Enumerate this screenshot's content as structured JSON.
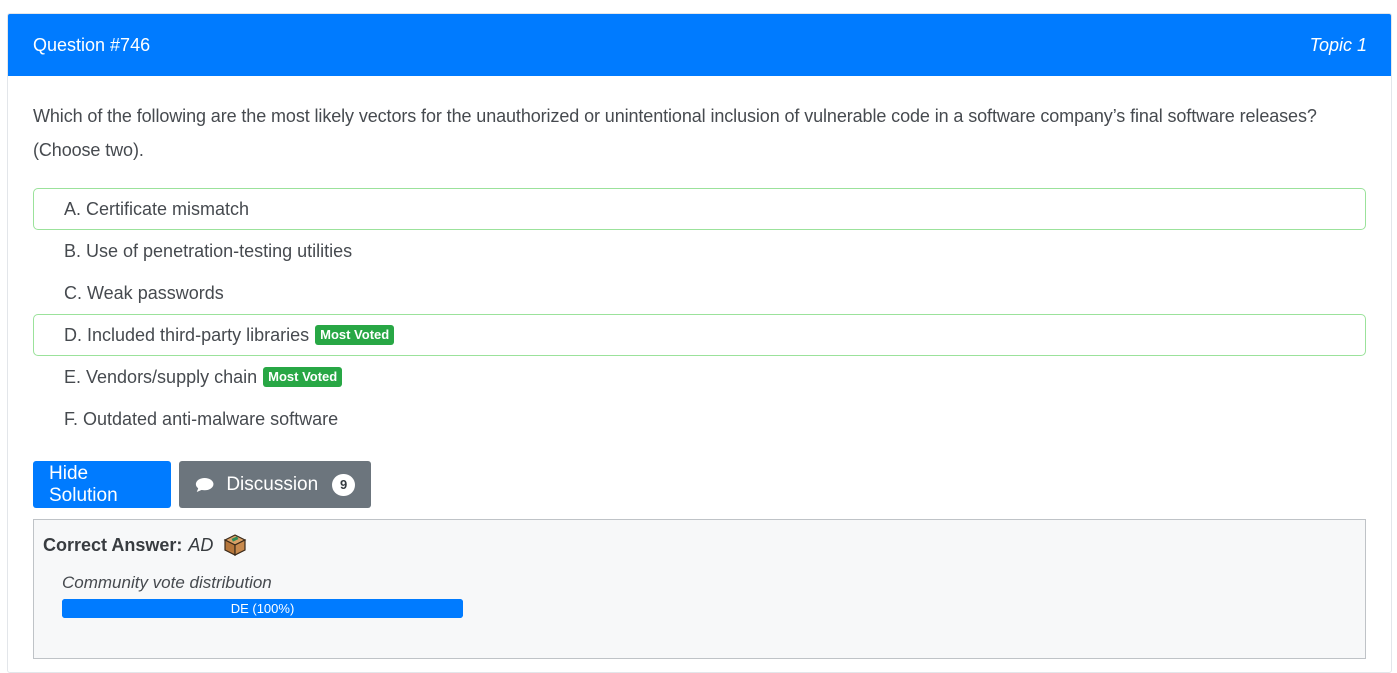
{
  "header": {
    "question": "Question #746",
    "topic": "Topic 1"
  },
  "question_text": "Which of the following are the most likely vectors for the unauthorized or unintentional inclusion of vulnerable code in a software company’s final software releases? (Choose two).",
  "choices": [
    {
      "text": "A. Certificate mismatch",
      "highlighted": true,
      "badge": ""
    },
    {
      "text": "B. Use of penetration-testing utilities",
      "highlighted": false,
      "badge": ""
    },
    {
      "text": "C. Weak passwords",
      "highlighted": false,
      "badge": ""
    },
    {
      "text": "D. Included third-party libraries",
      "highlighted": true,
      "badge": "Most Voted"
    },
    {
      "text": "E. Vendors/supply chain",
      "highlighted": false,
      "badge": "Most Voted"
    },
    {
      "text": "F. Outdated anti-malware software",
      "highlighted": false,
      "badge": ""
    }
  ],
  "buttons": {
    "hide_solution": "Hide Solution",
    "discussion": "Discussion",
    "discussion_count": "9"
  },
  "answer": {
    "label": "Correct Answer:",
    "value": "AD",
    "vote_label": "Community vote distribution",
    "vote_text": "DE (100%)",
    "vote_percent": 100
  },
  "colors": {
    "accent": "#007bff",
    "success": "#28a745",
    "secondary": "#6c757d"
  },
  "icons": {
    "discussion": "chat-bubble-icon",
    "answer": "box-icon"
  }
}
